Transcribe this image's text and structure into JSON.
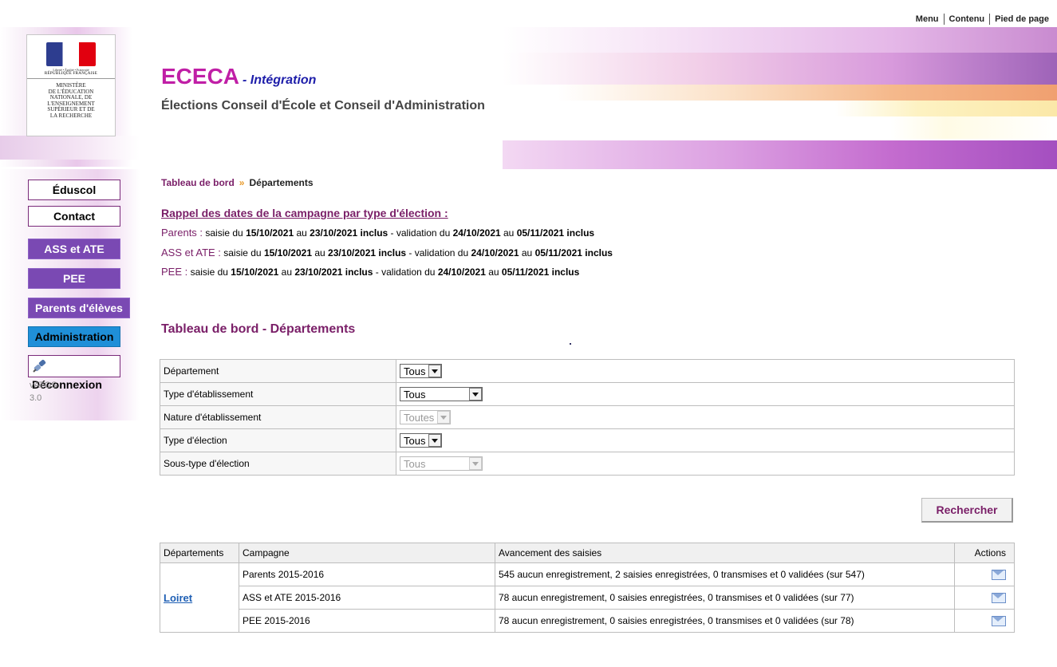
{
  "top_links": [
    "Menu",
    "Contenu",
    "Pied de page"
  ],
  "logo": {
    "motto": "Liberté • Égalité • Fraternité",
    "republic": "RÉPUBLIQUE FRANÇAISE",
    "ministry": [
      "MINISTÈRE",
      "DE L'ÉDUCATION",
      "NATIONALE, DE",
      "L'ENSEIGNEMENT",
      "SUPÉRIEUR ET DE",
      "LA RECHERCHE"
    ]
  },
  "header": {
    "title": "ECECA",
    "subtitle": "- Intégration",
    "description": "Élections Conseil d'École et Conseil d'Administration"
  },
  "sidebar": {
    "eduscol": "Éduscol",
    "contact": "Contact",
    "ass_ate": "ASS et ATE",
    "pee": "PEE",
    "parents": "Parents d'élèves",
    "administration": "Administration",
    "deconnexion": "Déconnexion",
    "version_name": "vATOS",
    "version_num": "3.0"
  },
  "breadcrumb": {
    "item1": "Tableau de bord",
    "separator": "»",
    "item2": "Départements"
  },
  "campaign": {
    "title": "Rappel des dates de la campagne par type d'élection :",
    "lines": [
      {
        "label": "Parents :",
        "t1": " saisie du ",
        "d1": "15/10/2021",
        "t2": " au ",
        "d2": "23/10/2021 inclus",
        "t3": " - validation du ",
        "d3": "24/10/2021",
        "t4": " au ",
        "d4": "05/11/2021 inclus"
      },
      {
        "label": "ASS et ATE :",
        "t1": " saisie du ",
        "d1": "15/10/2021",
        "t2": " au ",
        "d2": "23/10/2021 inclus",
        "t3": " - validation du ",
        "d3": "24/10/2021",
        "t4": " au ",
        "d4": "05/11/2021 inclus"
      },
      {
        "label": "PEE :",
        "t1": " saisie du ",
        "d1": "15/10/2021",
        "t2": " au ",
        "d2": "23/10/2021 inclus",
        "t3": " - validation du ",
        "d3": "24/10/2021",
        "t4": " au ",
        "d4": "05/11/2021 inclus"
      }
    ]
  },
  "section_title": "Tableau de bord - Départements",
  "filters": {
    "rows": [
      {
        "label": "Département",
        "value": "Tous",
        "disabled": false
      },
      {
        "label": "Type d'établissement",
        "value": "Tous",
        "disabled": false
      },
      {
        "label": "Nature d'établissement",
        "value": "Toutes",
        "disabled": true
      },
      {
        "label": "Type d'élection",
        "value": "Tous",
        "disabled": false
      },
      {
        "label": "Sous-type d'élection",
        "value": "Tous",
        "disabled": true
      }
    ],
    "search_button": "Rechercher"
  },
  "results": {
    "headers": {
      "departements": "Départements",
      "campagne": "Campagne",
      "avancement": "Avancement des saisies",
      "actions": "Actions"
    },
    "department": "Loiret",
    "rows": [
      {
        "campagne": "Parents 2015-2016",
        "avancement": "545 aucun enregistrement, 2 saisies enregistrées, 0 transmises et 0 validées (sur 547)"
      },
      {
        "campagne": "ASS et ATE 2015-2016",
        "avancement": "78 aucun enregistrement, 0 saisies enregistrées, 0 transmises et 0 validées (sur 77)"
      },
      {
        "campagne": "PEE 2015-2016",
        "avancement": "78 aucun enregistrement, 0 saisies enregistrées, 0 transmises et 0 validées (sur 78)"
      }
    ]
  },
  "colors": {
    "brand_magenta": "#c01fa6",
    "title_purple": "#7a1f68",
    "nav_purple": "#7a49b3",
    "nav_blue": "#1f8fd8",
    "link_blue": "#1e5fb4"
  }
}
